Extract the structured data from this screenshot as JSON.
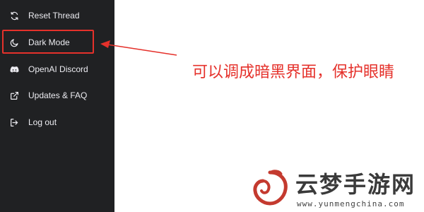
{
  "sidebar": {
    "items": [
      {
        "label": "Reset Thread",
        "icon": "refresh-icon"
      },
      {
        "label": "Dark Mode",
        "icon": "moon-icon"
      },
      {
        "label": "OpenAI Discord",
        "icon": "discord-icon"
      },
      {
        "label": "Updates & FAQ",
        "icon": "external-link-icon"
      },
      {
        "label": "Log out",
        "icon": "logout-icon"
      }
    ]
  },
  "annotation": {
    "text": "可以调成暗黑界面，保护眼睛",
    "color": "#e5312b"
  },
  "watermark": {
    "title": "云梦手游网",
    "url": "www.yunmengchina.com"
  },
  "colors": {
    "sidebar_bg": "#202123",
    "sidebar_text": "#ececf1",
    "highlight": "#e5312b"
  }
}
